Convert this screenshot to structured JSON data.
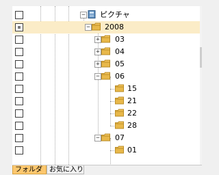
{
  "tree": {
    "rows": [
      {
        "label": "ピクチャ",
        "icon": "library-icon",
        "check": "empty",
        "expand": "minus",
        "level": 0,
        "name": "tree-item-pictures"
      },
      {
        "label": "2008",
        "icon": "folder-icon",
        "check": "partial",
        "expand": "minus",
        "level": 1,
        "selected": true,
        "name": "tree-item-2008"
      },
      {
        "label": "03",
        "icon": "folder-icon",
        "check": "empty",
        "expand": "plus",
        "level": 2,
        "name": "tree-item-03"
      },
      {
        "label": "04",
        "icon": "folder-icon",
        "check": "empty",
        "expand": "plus",
        "level": 2,
        "name": "tree-item-04"
      },
      {
        "label": "05",
        "icon": "folder-icon",
        "check": "empty",
        "expand": "plus",
        "level": 2,
        "name": "tree-item-05"
      },
      {
        "label": "06",
        "icon": "folder-icon",
        "check": "empty",
        "expand": "minus",
        "level": 2,
        "name": "tree-item-06"
      },
      {
        "label": "15",
        "icon": "folder-icon",
        "check": "empty",
        "expand": "none",
        "level": 3,
        "name": "tree-item-06-15"
      },
      {
        "label": "21",
        "icon": "folder-icon",
        "check": "empty",
        "expand": "none",
        "level": 3,
        "name": "tree-item-06-21"
      },
      {
        "label": "22",
        "icon": "folder-icon",
        "check": "empty",
        "expand": "none",
        "level": 3,
        "name": "tree-item-06-22"
      },
      {
        "label": "28",
        "icon": "folder-icon",
        "check": "empty",
        "expand": "none",
        "level": 3,
        "name": "tree-item-06-28"
      },
      {
        "label": "07",
        "icon": "folder-icon",
        "check": "empty",
        "expand": "minus",
        "level": 2,
        "name": "tree-item-07"
      },
      {
        "label": "01",
        "icon": "folder-icon",
        "check": "empty",
        "expand": "none",
        "level": 3,
        "name": "tree-item-07-01"
      }
    ]
  },
  "tabs": [
    {
      "label": "フォルダ",
      "active": true,
      "name": "tab-folder"
    },
    {
      "label": "お気に入り",
      "active": false,
      "name": "tab-favorites"
    }
  ],
  "colors": {
    "selected_row": "#fbecc7",
    "active_tab": "#fcc76e",
    "folder": "#e8b84a"
  }
}
